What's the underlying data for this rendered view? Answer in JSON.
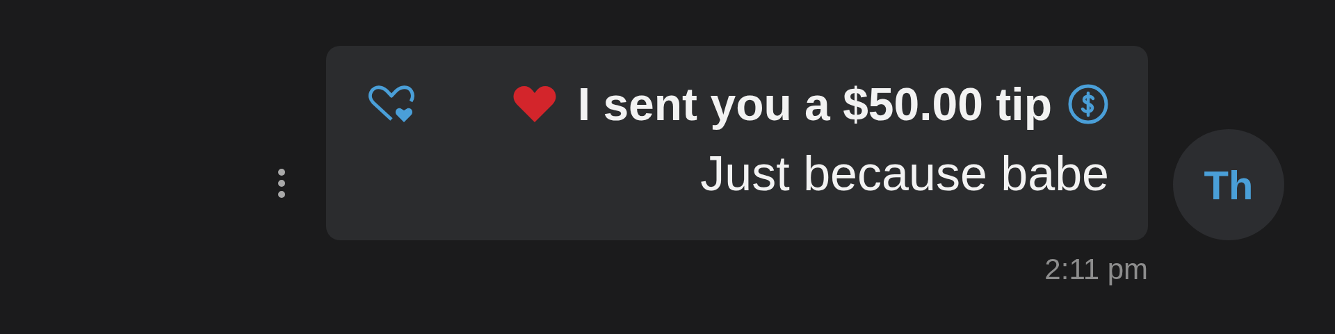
{
  "message": {
    "avatar": "Th",
    "tip": "I sent you a $50.00 tip",
    "text": "Just because babe",
    "time": "2:11 pm"
  }
}
